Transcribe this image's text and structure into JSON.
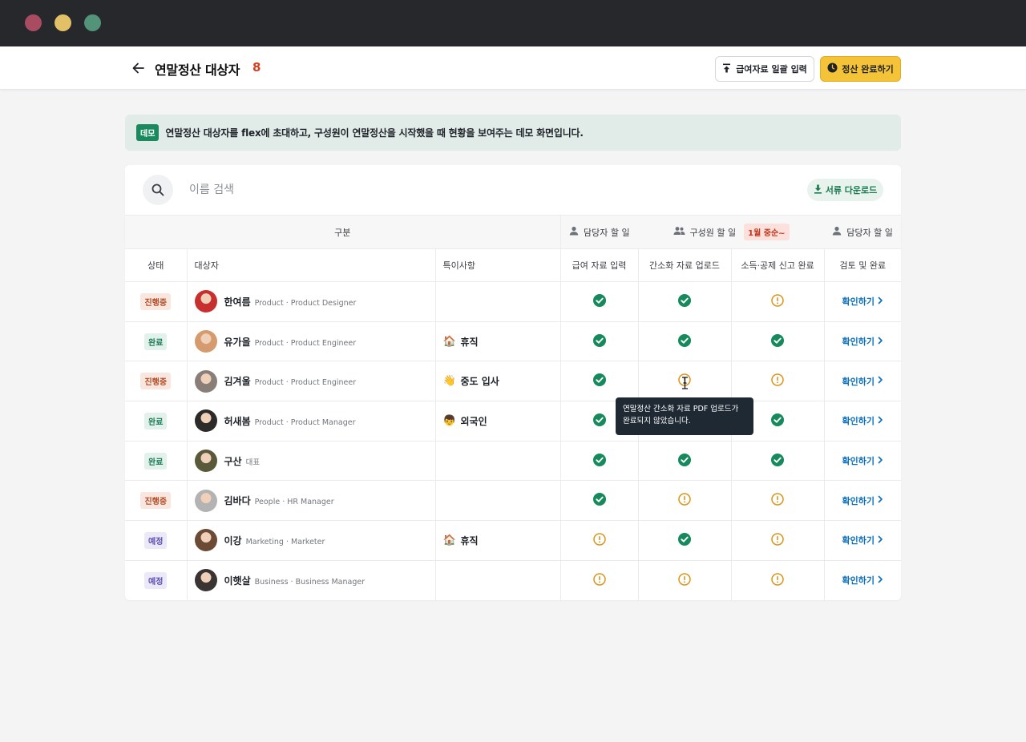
{
  "window": {
    "dots": [
      "#a94c62",
      "#e2c067",
      "#53937a"
    ]
  },
  "header": {
    "title": "연말정산 대상자",
    "count": "8",
    "upload_label": "급여자료 일괄 입력",
    "complete_label": "정산 완료하기"
  },
  "banner": {
    "badge": "데모",
    "text": "연말정산 대상자를 flex에 초대하고, 구성원이 연말정산을 시작했을 때 현황을 보여주는 데모 화면입니다."
  },
  "search": {
    "placeholder": "이름 검색",
    "download_label": "서류 다운로드"
  },
  "table": {
    "groups": {
      "category": "구분",
      "manager1": "담당자 할 일",
      "member": "구성원 할 일",
      "member_badge": "1월 중순~",
      "manager2": "담당자 할 일"
    },
    "columns": [
      "상태",
      "대상자",
      "특이사항",
      "급여 자료 입력",
      "간소화 자료 업로드",
      "소득·공제 신고 완료",
      "검토 및 완료"
    ],
    "confirm_label": "확인하기",
    "rows": [
      {
        "status": "진행중",
        "status_type": "prog",
        "name": "한여름",
        "role": "Product · Product Designer",
        "note": "",
        "note_icon": "",
        "c1": "ok",
        "c2": "ok",
        "c3": "warn",
        "avatar": "#c8302f"
      },
      {
        "status": "완료",
        "status_type": "done",
        "name": "유가을",
        "role": "Product · Product Engineer",
        "note": "휴직",
        "note_icon": "🏠",
        "c1": "ok",
        "c2": "ok",
        "c3": "ok",
        "avatar": "#d59a6e"
      },
      {
        "status": "진행중",
        "status_type": "prog",
        "name": "김겨울",
        "role": "Product · Product Engineer",
        "note": "중도 입사",
        "note_icon": "👋",
        "c1": "ok",
        "c2": "warn",
        "c3": "warn",
        "avatar": "#8a7f78"
      },
      {
        "status": "완료",
        "status_type": "done",
        "name": "허새봄",
        "role": "Product · Product Manager",
        "note": "외국인",
        "note_icon": "👦",
        "c1": "ok",
        "c2": "ok",
        "c3": "ok",
        "avatar": "#2d2a2a"
      },
      {
        "status": "완료",
        "status_type": "done",
        "name": "구산",
        "role": "대표",
        "note": "",
        "note_icon": "",
        "c1": "ok",
        "c2": "ok",
        "c3": "ok",
        "avatar": "#5a5a3a"
      },
      {
        "status": "진행중",
        "status_type": "prog",
        "name": "김바다",
        "role": "People · HR Manager",
        "note": "",
        "note_icon": "",
        "c1": "ok",
        "c2": "warn",
        "c3": "warn",
        "avatar": "#b3b3b3"
      },
      {
        "status": "예정",
        "status_type": "plan",
        "name": "이강",
        "role": "Marketing · Marketer",
        "note": "휴직",
        "note_icon": "🏠",
        "c1": "warn",
        "c2": "ok",
        "c3": "warn",
        "avatar": "#6b4a36"
      },
      {
        "status": "예정",
        "status_type": "plan",
        "name": "이햇살",
        "role": "Business · Business Manager",
        "note": "",
        "note_icon": "",
        "c1": "warn",
        "c2": "warn",
        "c3": "warn",
        "avatar": "#3a3433"
      }
    ]
  },
  "tooltip": {
    "line1": "연말정산 간소화 자료 PDF 업로드가",
    "line2": "완료되지 않았습니다."
  },
  "colors": {
    "ok": "#168a5c",
    "warn": "#d9961c",
    "link": "#0a6fbd",
    "accent": "#f5c337"
  }
}
